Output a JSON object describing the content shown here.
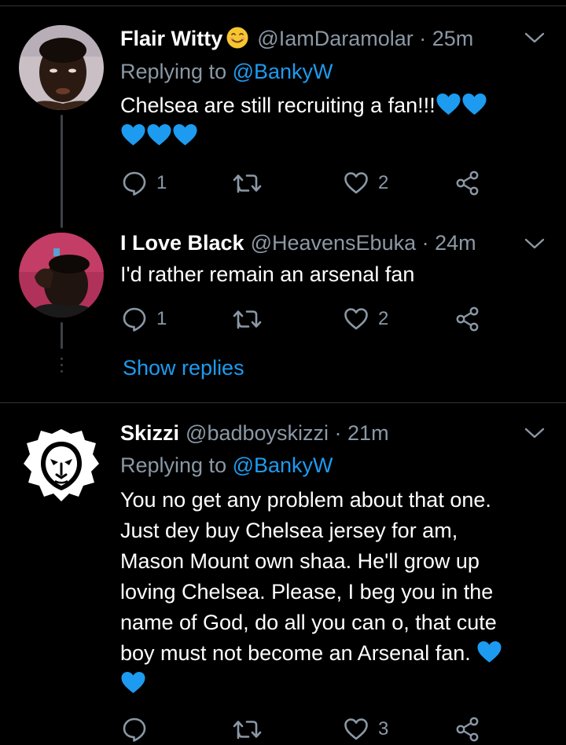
{
  "tweets": [
    {
      "name": "Flair Witty",
      "handle": "@IamDaramolar",
      "time": "25m",
      "replying_prefix": "Replying to ",
      "replying_to": "@BankyW",
      "text": "Chelsea are still recruiting a fan!!!",
      "reply_count": "1",
      "like_count": "2"
    },
    {
      "name": "I Love Black",
      "handle": "@HeavensEbuka",
      "time": "24m",
      "text": "I'd rather remain an arsenal fan",
      "reply_count": "1",
      "like_count": "2",
      "show_replies": "Show replies"
    },
    {
      "name": "Skizzi",
      "handle": "@badboyskizzi",
      "time": "21m",
      "replying_prefix": "Replying to ",
      "replying_to": "@BankyW",
      "lines": [
        "You no get any problem about that one.",
        "Just dey buy Chelsea jersey for am,",
        "Mason Mount own shaa. He'll grow up",
        "loving Chelsea. Please, I beg you in the",
        "name of God, do all you can o, that cute",
        "boy must not become an Arsenal fan."
      ],
      "like_count": "3"
    }
  ],
  "separator": " · ",
  "colors": {
    "background": "#000000",
    "secondary_text": "#8b98a5",
    "link": "#1d9bf0",
    "heart_emoji": "#1d9bf0",
    "divider": "#2f3336"
  },
  "icons": {
    "reply": "speech-bubble-icon",
    "retweet": "retweet-icon",
    "like": "heart-icon",
    "share": "share-icon",
    "more": "chevron-down-icon"
  }
}
